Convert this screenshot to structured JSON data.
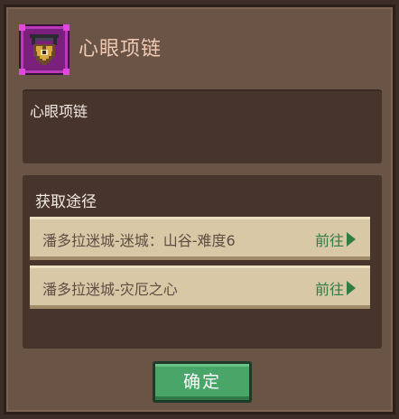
{
  "header": {
    "item_icon": "heart-eye-necklace-icon",
    "title": "心眼项链"
  },
  "description": {
    "text": "心眼项链"
  },
  "sources": {
    "title": "获取途径",
    "items": [
      {
        "label": "潘多拉迷城-迷城：山谷-难度6",
        "go_label": "前往",
        "go_icon": "arrow-right-icon"
      },
      {
        "label": "潘多拉迷城-灾厄之心",
        "go_label": "前往",
        "go_icon": "arrow-right-icon"
      }
    ]
  },
  "confirm_label": "确定",
  "colors": {
    "panel": "#6a5446",
    "inner_box": "#47342b",
    "row": "#d8c8a6",
    "go_green": "#2e7d4a",
    "confirm_green": "#4aa568",
    "title": "#f1c9b3",
    "icon_frame": "#b93ab8"
  }
}
